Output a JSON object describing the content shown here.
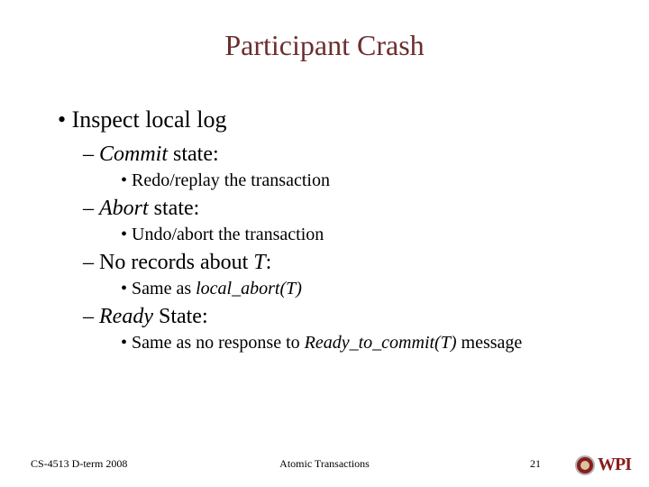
{
  "title": "Participant Crash",
  "bullets": {
    "b1": "Inspect local log",
    "s1": {
      "pre": "Commit",
      "post": " state:"
    },
    "s1_sub": "Redo/replay the transaction",
    "s2": {
      "pre": "Abort",
      "post": " state:"
    },
    "s2_sub": "Undo/abort the transaction",
    "s3": {
      "pre": "No records about ",
      "it": "T",
      "post": ":"
    },
    "s3_sub": {
      "pre": "Same as ",
      "it": "local_abort(T)"
    },
    "s4": {
      "pre": "Ready",
      "post": " State:"
    },
    "s4_sub": {
      "pre": "Same as no response to ",
      "it": "Ready_to_commit(T)",
      "post": " message"
    }
  },
  "footer": {
    "left": "CS-4513 D-term 2008",
    "center": "Atomic Transactions",
    "page": "21",
    "logo_text": "WPI"
  }
}
